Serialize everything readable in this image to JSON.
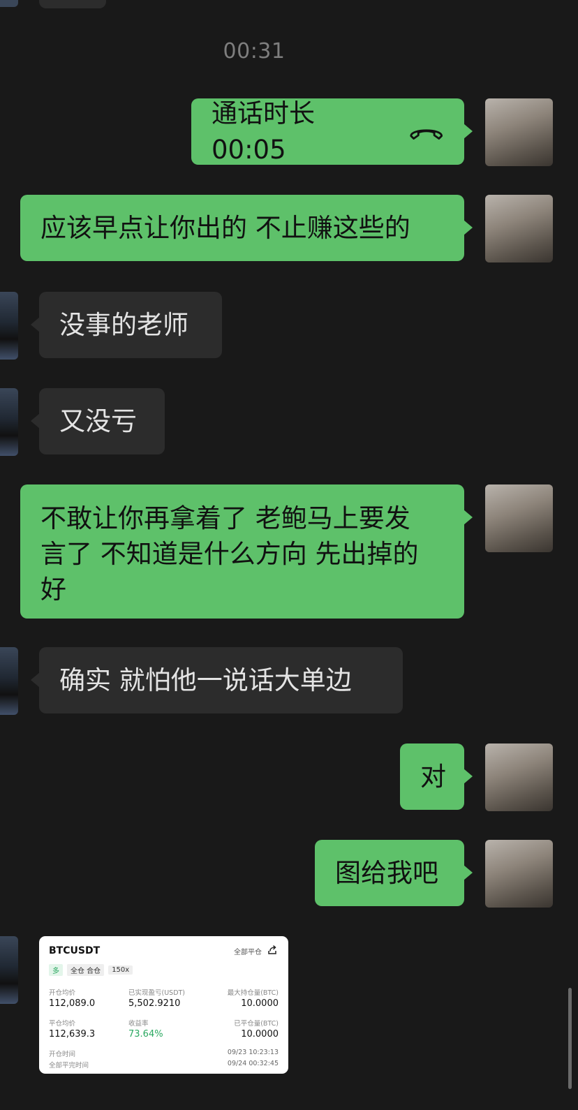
{
  "timestamp": "00:31",
  "messages": {
    "call": "通话时长 00:05",
    "m1": "应该早点让你出的 不止赚这些的",
    "m2": "没事的老师",
    "m3": "又没亏",
    "m4_line1": "不敢让你再拿着了 老鲍马上要发",
    "m4_line2": "言了 不知道是什么方向 先出掉的",
    "m4_line3": "好",
    "m5": "确实 就怕他一说话大单边",
    "m6": "对",
    "m7": "图给我吧"
  },
  "card": {
    "symbol": "BTCUSDT",
    "close_all": "全部平仓",
    "tag_long": "多",
    "tag_margin": "全仓 合仓",
    "tag_leverage": "150x",
    "open_price_label": "开仓均价",
    "open_price": "112,089.0",
    "realized_pnl_label": "已实现盈亏(USDT)",
    "realized_pnl": "5,502.9210",
    "max_position_label": "最大持仓量(BTC)",
    "max_position": "10.0000",
    "close_price_label": "平仓均价",
    "close_price": "112,639.3",
    "roi_label": "收益率",
    "roi": "73.64%",
    "closed_qty_label": "已平仓量(BTC)",
    "closed_qty": "10.0000",
    "open_time_label": "开仓时间",
    "open_time": "09/23 10:23:13",
    "close_time_label": "全部平完时间",
    "close_time": "09/24 00:32:45"
  },
  "colors": {
    "background": "#191919",
    "bubble_me": "#5ec16a",
    "bubble_other": "#2c2c2c",
    "profit_green": "#2aa860"
  },
  "icons": [
    "phone-hangup-icon",
    "share-icon"
  ]
}
